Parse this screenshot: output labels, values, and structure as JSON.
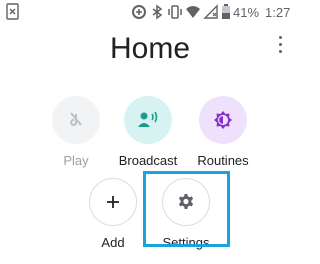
{
  "status_bar": {
    "battery": "41%",
    "time": "1:27",
    "icons": [
      "notification-icon",
      "data-saver-icon",
      "bluetooth-icon",
      "vibrate-icon",
      "wifi-icon",
      "no-signal-icon",
      "battery-icon"
    ]
  },
  "header": {
    "title": "Home",
    "menu_icon": "more-vert-icon"
  },
  "actions": {
    "play": {
      "label": "Play",
      "icon": "play-disabled-icon",
      "enabled": false
    },
    "broadcast": {
      "label": "Broadcast",
      "icon": "broadcast-icon",
      "color": "#1a9b8f"
    },
    "routines": {
      "label": "Routines",
      "icon": "routines-icon",
      "color": "#8430ce"
    },
    "add": {
      "label": "Add",
      "icon": "plus-icon"
    },
    "settings": {
      "label": "Settings",
      "icon": "gear-icon"
    }
  },
  "colors": {
    "highlight": "#1aa2dc"
  }
}
